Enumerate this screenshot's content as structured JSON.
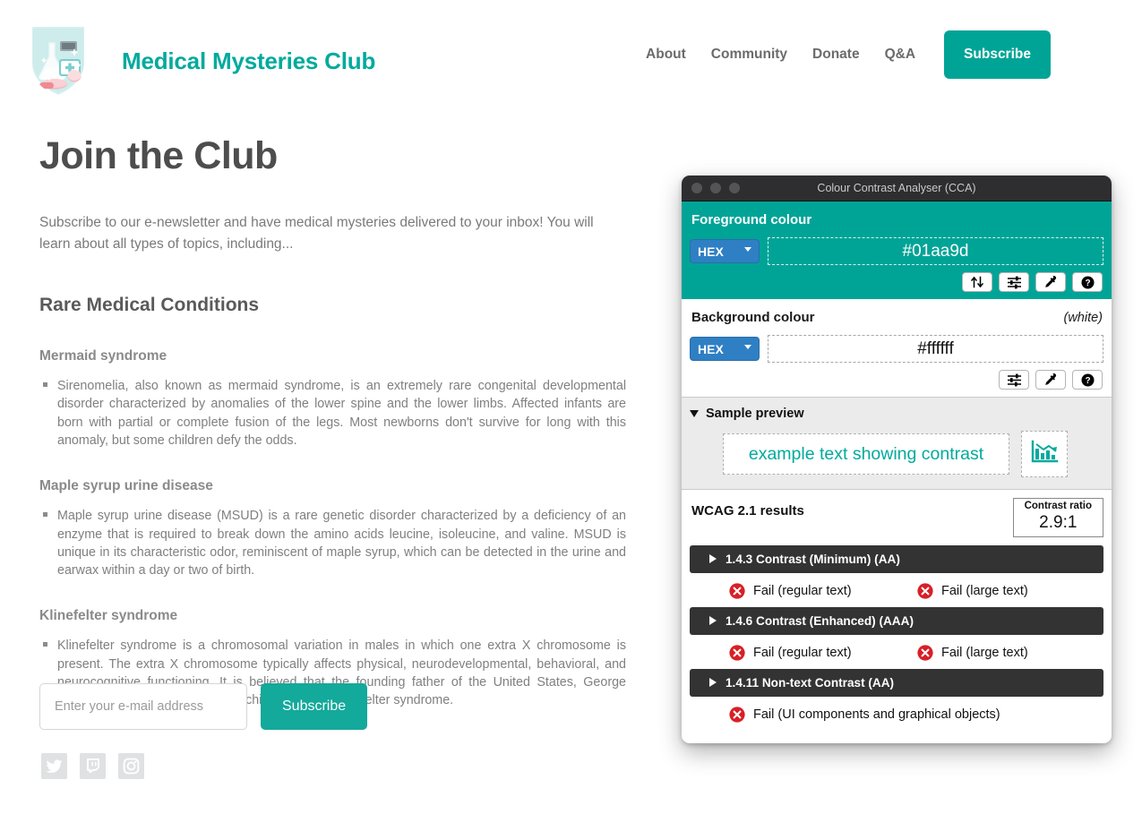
{
  "header": {
    "logo_icon": "medical-shield-logo",
    "brand_name": "Medical Mysteries Club",
    "nav": [
      {
        "label": "About"
      },
      {
        "label": "Community"
      },
      {
        "label": "Donate"
      },
      {
        "label": "Q&A"
      }
    ],
    "subscribe_label": "Subscribe",
    "accent_color": "#00a497"
  },
  "main": {
    "page_title": "Join the Club",
    "intro": "Subscribe to our e-newsletter and have medical mysteries delivered to your inbox! You will learn about all types of topics, including...",
    "section_heading": "Rare Medical Conditions",
    "conditions": [
      {
        "title": "Mermaid syndrome",
        "body": "Sirenomelia, also known as mermaid syndrome, is an extremely rare congenital developmental disorder characterized by anomalies of the lower spine and the lower limbs. Affected infants are born with partial or complete fusion of the legs. Most newborns don't survive for long with this anomaly, but some children defy the odds."
      },
      {
        "title": "Maple syrup urine disease",
        "body": "Maple syrup urine disease (MSUD) is a rare genetic disorder characterized by a deficiency of an enzyme that is required to break down the amino acids leucine, isoleucine, and valine. MSUD is unique in its characteristic odor, reminiscent of maple syrup, which can be detected in the urine and earwax within a day or two of birth."
      },
      {
        "title": "Klinefelter syndrome",
        "body": "Klinefelter syndrome is a chromosomal variation in males in which one extra X chromosome is present. The extra X chromosome typically affects physical, neurodevelopmental, behavioral, and neurocognitive functioning. It is believed that the founding father of the United States, George Washington, was unable to have children due to Klinefelter syndrome."
      }
    ],
    "form": {
      "email_placeholder": "Enter your e-mail address",
      "email_value": "",
      "submit_label": "Subscribe"
    },
    "social": [
      {
        "name": "twitter-icon"
      },
      {
        "name": "twitch-icon"
      },
      {
        "name": "instagram-icon"
      }
    ]
  },
  "cca": {
    "window_title": "Colour Contrast Analyser (CCA)",
    "foreground": {
      "section_label": "Foreground colour",
      "format": "HEX",
      "value": "#01aa9d",
      "buttons": [
        "swap-colours-icon",
        "sliders-icon",
        "eyedropper-icon",
        "help-icon"
      ]
    },
    "background": {
      "section_label": "Background colour",
      "note": "(white)",
      "format": "HEX",
      "value": "#ffffff",
      "buttons": [
        "sliders-icon",
        "eyedropper-icon",
        "help-icon"
      ]
    },
    "sample_preview": {
      "section_label": "Sample preview",
      "sample_text": "example text showing contrast",
      "graphic_icon": "declining-bar-chart-icon"
    },
    "results": {
      "title": "WCAG 2.1 results",
      "contrast_ratio_label": "Contrast ratio",
      "contrast_ratio_value": "2.9:1",
      "criteria": [
        {
          "name": "1.4.3 Contrast (Minimum) (AA)",
          "results": [
            {
              "status": "Fail (regular text)"
            },
            {
              "status": "Fail (large text)"
            }
          ]
        },
        {
          "name": "1.4.6 Contrast (Enhanced) (AAA)",
          "results": [
            {
              "status": "Fail (regular text)"
            },
            {
              "status": "Fail (large text)"
            }
          ]
        },
        {
          "name": "1.4.11 Non-text Contrast (AA)",
          "results": [
            {
              "status": "Fail (UI components and graphical objects)"
            }
          ]
        }
      ]
    }
  }
}
